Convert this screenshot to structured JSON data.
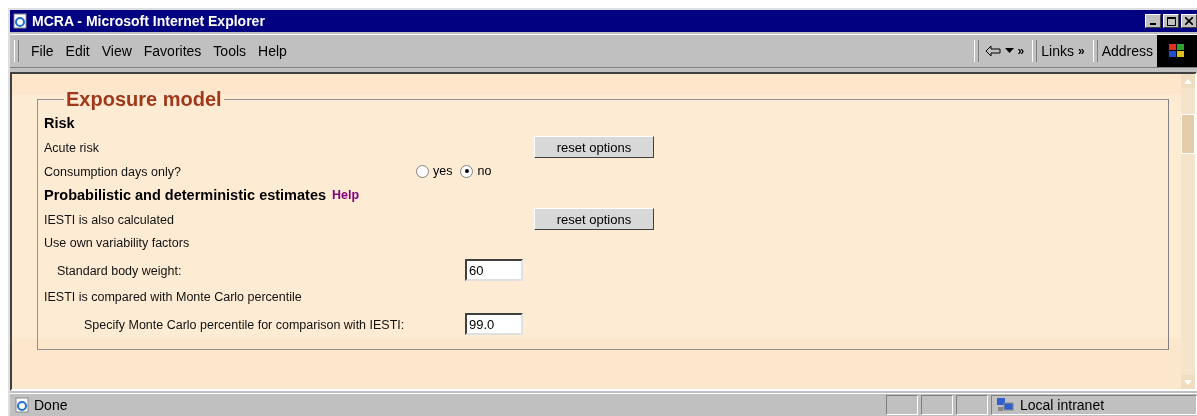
{
  "window": {
    "title": "MCRA - Microsoft Internet Explorer"
  },
  "menu": [
    "File",
    "Edit",
    "View",
    "Favorites",
    "Tools",
    "Help"
  ],
  "toolbar": {
    "back_chevron": "»",
    "links_label": "Links",
    "links_chevron": "»",
    "address_label": "Address"
  },
  "section": {
    "legend": "Exposure model",
    "rows": [
      {
        "kind": "heading",
        "text": "Risk"
      },
      {
        "kind": "button",
        "text": "Acute risk",
        "button": "reset options"
      },
      {
        "kind": "radio",
        "text": "Consumption days only?",
        "options": [
          {
            "label": "yes",
            "selected": false
          },
          {
            "label": "no",
            "selected": true
          }
        ]
      },
      {
        "kind": "heading",
        "text": "Probabilistic and deterministic estimates",
        "link": "Help"
      },
      {
        "kind": "button",
        "text": "IESTI is also calculated",
        "button": "reset options"
      },
      {
        "kind": "label",
        "text": "Use own variability factors"
      },
      {
        "kind": "input",
        "text": "Standard body weight:",
        "value": "60"
      },
      {
        "kind": "label",
        "text": "IESTI is compared with Monte Carlo percentile"
      },
      {
        "kind": "deepinput",
        "text": "Specify Monte Carlo percentile for comparison with IESTI:",
        "value": "99.0"
      }
    ]
  },
  "status_bar": {
    "text": "Done",
    "zone": "Local intranet"
  }
}
